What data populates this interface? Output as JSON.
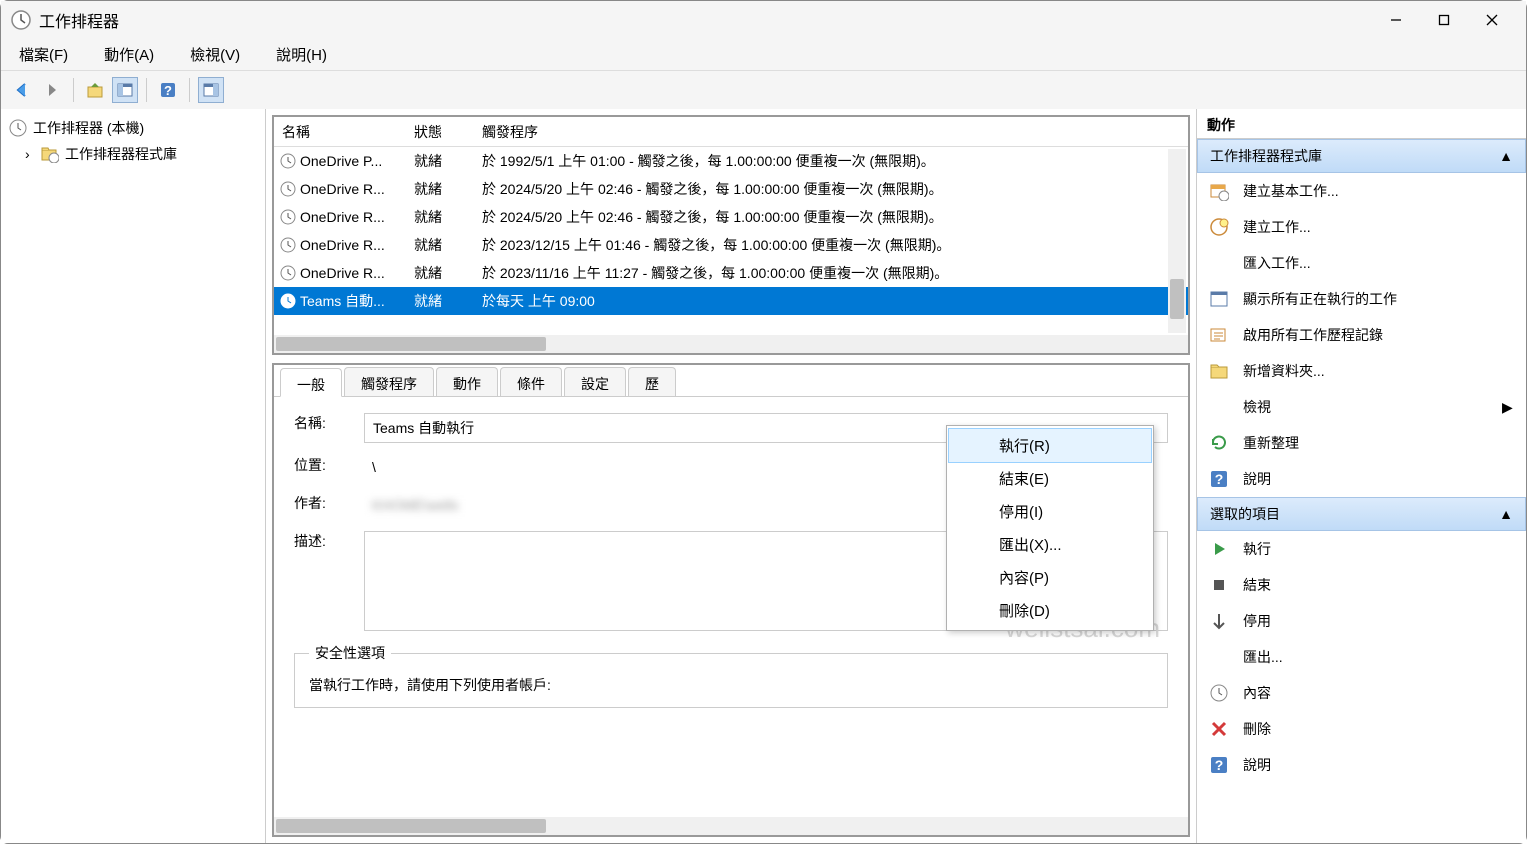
{
  "title": "工作排程器",
  "menubar": {
    "file": "檔案(F)",
    "action": "動作(A)",
    "view": "檢視(V)",
    "help": "說明(H)"
  },
  "tree": {
    "root": "工作排程器 (本機)",
    "library": "工作排程器程式庫"
  },
  "taskList": {
    "headers": {
      "name": "名稱",
      "status": "狀態",
      "trigger": "觸發程序"
    },
    "rows": [
      {
        "name": "OneDrive P...",
        "status": "就緒",
        "trigger": "於 1992/5/1 上午 01:00 - 觸發之後，每 1.00:00:00 便重複一次 (無限期)。"
      },
      {
        "name": "OneDrive R...",
        "status": "就緒",
        "trigger": "於 2024/5/20 上午 02:46 - 觸發之後，每 1.00:00:00 便重複一次 (無限期)。"
      },
      {
        "name": "OneDrive R...",
        "status": "就緒",
        "trigger": "於 2024/5/20 上午 02:46 - 觸發之後，每 1.00:00:00 便重複一次 (無限期)。"
      },
      {
        "name": "OneDrive R...",
        "status": "就緒",
        "trigger": "於 2023/12/15 上午 01:46 - 觸發之後，每 1.00:00:00 便重複一次 (無限期)。"
      },
      {
        "name": "OneDrive R...",
        "status": "就緒",
        "trigger": "於 2023/11/16 上午 11:27 - 觸發之後，每 1.00:00:00 便重複一次 (無限期)。"
      },
      {
        "name": "Teams 自動...",
        "status": "就緒",
        "trigger": "於每天 上午 09:00"
      }
    ]
  },
  "detailTabs": {
    "general": "一般",
    "triggers": "觸發程序",
    "actions": "動作",
    "conditions": "條件",
    "settings": "設定",
    "history": "歷"
  },
  "detail": {
    "nameLabel": "名稱:",
    "nameValue": "Teams 自動執行",
    "locationLabel": "位置:",
    "locationValue": "\\",
    "authorLabel": "作者:",
    "authorValue": "KHOME\\wells",
    "descLabel": "描述:",
    "securityLegend": "安全性選項",
    "securityLine1": "當執行工作時，請使用下列使用者帳戶:"
  },
  "contextMenu": {
    "run": "執行(R)",
    "end": "結束(E)",
    "disable": "停用(I)",
    "export": "匯出(X)...",
    "properties": "內容(P)",
    "delete": "刪除(D)"
  },
  "actionsPane": {
    "title": "動作",
    "group1": "工作排程器程式庫",
    "items1": [
      {
        "icon": "create-basic",
        "label": "建立基本工作..."
      },
      {
        "icon": "create",
        "label": "建立工作..."
      },
      {
        "icon": "import",
        "label": "匯入工作..."
      },
      {
        "icon": "running",
        "label": "顯示所有正在執行的工作"
      },
      {
        "icon": "history",
        "label": "啟用所有工作歷程記錄"
      },
      {
        "icon": "folder",
        "label": "新增資料夾..."
      },
      {
        "icon": "view",
        "label": "檢視",
        "chevron": true
      },
      {
        "icon": "refresh",
        "label": "重新整理"
      },
      {
        "icon": "help",
        "label": "說明"
      }
    ],
    "group2": "選取的項目",
    "items2": [
      {
        "icon": "run",
        "label": "執行"
      },
      {
        "icon": "end",
        "label": "結束"
      },
      {
        "icon": "disable",
        "label": "停用"
      },
      {
        "icon": "export",
        "label": "匯出..."
      },
      {
        "icon": "properties",
        "label": "內容"
      },
      {
        "icon": "delete",
        "label": "刪除"
      },
      {
        "icon": "help2",
        "label": "說明"
      }
    ]
  },
  "watermark": "wellstsai.com"
}
